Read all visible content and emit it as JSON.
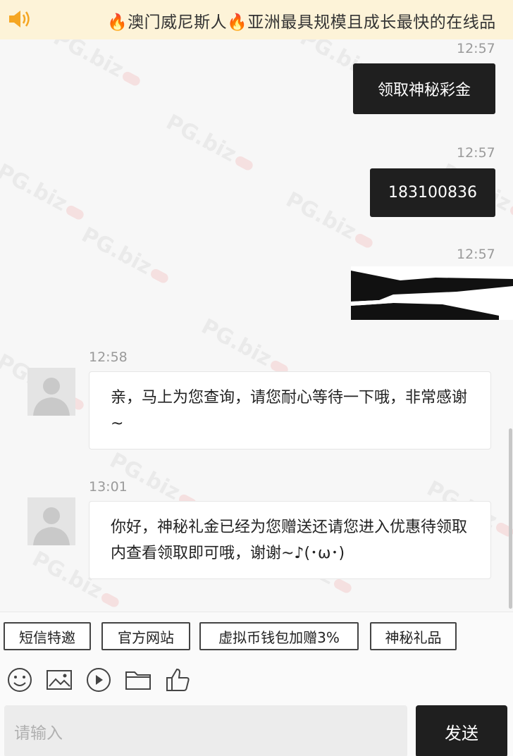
{
  "banner": {
    "marquee": "🔥澳门威尼斯人🔥亚洲最具规模且成长最快的在线品"
  },
  "messages": [
    {
      "side": "out",
      "time": "12:57",
      "text": "领取神秘彩金"
    },
    {
      "side": "out",
      "time": "12:57",
      "text": "183100836"
    },
    {
      "side": "out",
      "time": "12:57",
      "text": ""
    },
    {
      "side": "in",
      "time": "12:58",
      "text": "亲，马上为您查询，请您耐心等待一下哦，非常感谢~"
    },
    {
      "side": "in",
      "time": "13:01",
      "text": "你好，神秘礼金已经为您赠送还请您进入优惠待领取 内查看领取即可哦，谢谢~♪(･ω･)"
    }
  ],
  "quick_replies": [
    "短信特邀",
    "官方网站",
    "虚拟币钱包加赠3%",
    "神秘礼品"
  ],
  "toolbar_icons": [
    "emoji-icon",
    "image-icon",
    "video-icon",
    "folder-icon",
    "thumbs-up-icon"
  ],
  "input": {
    "placeholder": "请输入"
  },
  "send_label": "发送",
  "watermark_text": "PG.biz",
  "colors": {
    "banner_bg": "#fdf3d8",
    "accent": "#f5a623",
    "dark_bubble": "#1f1f1f"
  }
}
